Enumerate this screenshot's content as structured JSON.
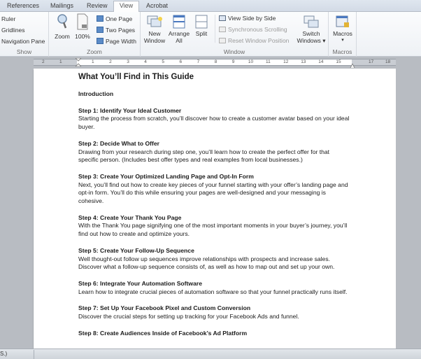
{
  "tabs": [
    {
      "label": "References",
      "active": false
    },
    {
      "label": "Mailings",
      "active": false
    },
    {
      "label": "Review",
      "active": false
    },
    {
      "label": "View",
      "active": true
    },
    {
      "label": "Acrobat",
      "active": false
    }
  ],
  "ribbon": {
    "show": {
      "label": "Show",
      "items": [
        "Ruler",
        "Gridlines",
        "Navigation Pane"
      ]
    },
    "zoom": {
      "label": "Zoom",
      "zoom_button": "Zoom",
      "hundred_button": "100%",
      "one_page": "One Page",
      "two_pages": "Two Pages",
      "page_width": "Page Width"
    },
    "window": {
      "label": "Window",
      "new_window": [
        "New",
        "Window"
      ],
      "arrange_all": [
        "Arrange",
        "All"
      ],
      "split": "Split",
      "view_side_by_side": "View Side by Side",
      "synchronous_scrolling": "Synchronous Scrolling",
      "reset_window_position": "Reset Window Position",
      "switch_windows": [
        "Switch",
        "Windows ▾"
      ]
    },
    "macros": {
      "label": "Macros",
      "macros_button": "Macros",
      "dropdown": "▾"
    }
  },
  "ruler": {
    "left_ticks": [
      "2",
      "1"
    ],
    "ticks": [
      "1",
      "2",
      "3",
      "4",
      "5",
      "6",
      "7",
      "8",
      "9",
      "10",
      "11",
      "12",
      "13",
      "14",
      "15"
    ],
    "right_ticks": [
      "17",
      "18"
    ]
  },
  "document": {
    "title": "What You’ll Find in This Guide",
    "intro": "Introduction",
    "sections": [
      {
        "title": "Step 1: Identify Your Ideal Customer",
        "body": "Starting the process from scratch, you’ll discover how to create a customer avatar based on your ideal buyer."
      },
      {
        "title": "Step 2: Decide What to Offer",
        "body": "Drawing from your research during step one, you’ll learn how to create the perfect offer for that specific person. (Includes best offer types and real examples from local businesses.)"
      },
      {
        "title": "Step 3: Create Your Optimized Landing Page and Opt-In Form",
        "body": "Next, you’ll find out how to create key pieces of your funnel starting with your offer’s landing page and opt-in form. You’ll do this while ensuring your pages are well-designed and your messaging is cohesive."
      },
      {
        "title": "Step 4: Create Your Thank You Page",
        "body": "With the Thank You page signifying one of the most important moments in your buyer’s journey, you’ll find out how to create and optimize yours."
      },
      {
        "title": "Step 5: Create Your Follow-Up Sequence",
        "body": "Well thought-out follow up sequences improve relationships with prospects and increase sales. Discover what a follow-up sequence consists of, as well as how to map out and set up your own."
      },
      {
        "title": "Step 6: Integrate Your Automation Software",
        "body": "Learn how to integrate crucial pieces of automation software so that your funnel practically runs itself."
      },
      {
        "title": "Step 7: Set Up Your Facebook Pixel and Custom Conversion",
        "body": "Discover the crucial steps for setting up tracking for your Facebook Ads and funnel."
      },
      {
        "title": "Step 8: Create Audiences Inside of Facebook’s Ad Platform",
        "body": ""
      }
    ]
  },
  "statusbar": {
    "text": "S.)"
  }
}
